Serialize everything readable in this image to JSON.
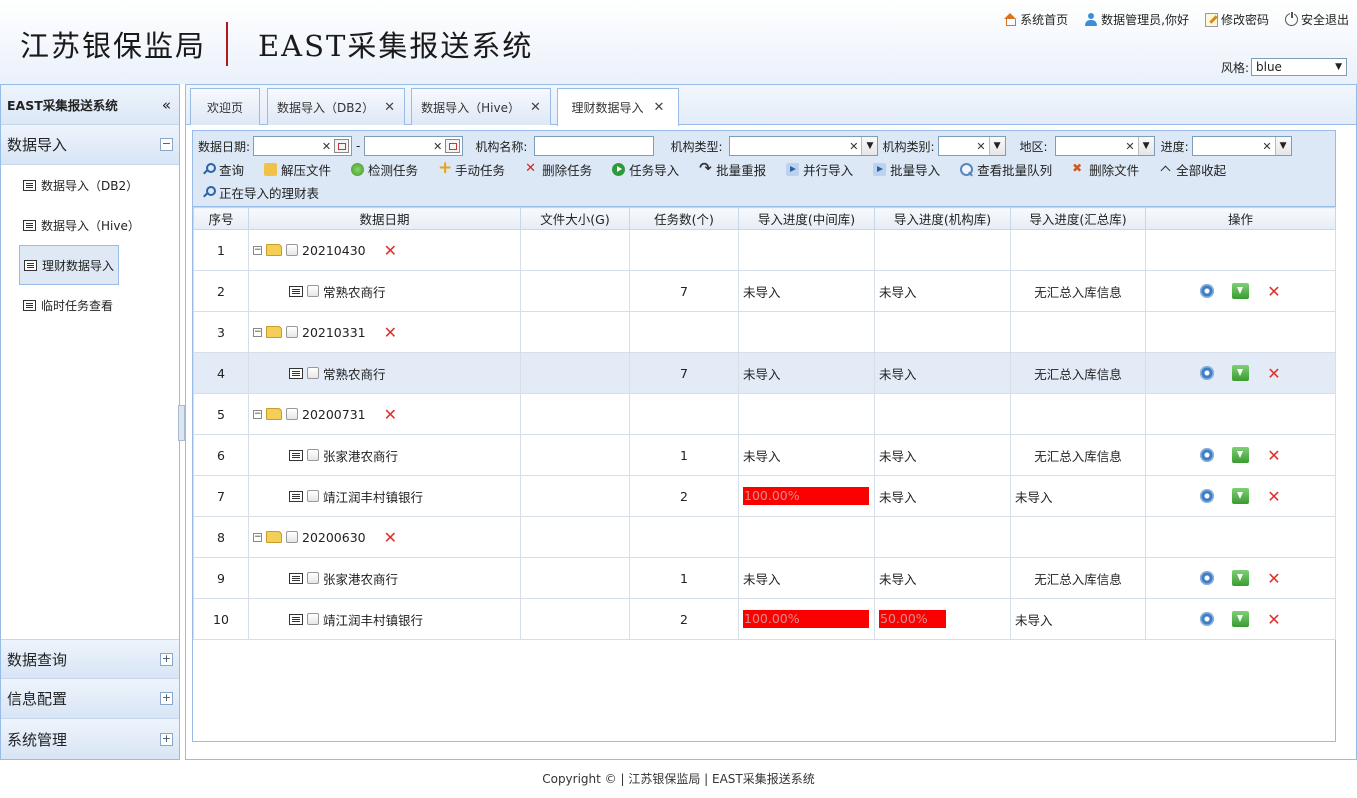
{
  "header": {
    "org_name": "江苏银保监局",
    "system_name": "EAST采集报送系统",
    "links": [
      {
        "label": "系统首页",
        "icon": "home-icon"
      },
      {
        "label": "数据管理员,你好",
        "icon": "user-icon"
      },
      {
        "label": "修改密码",
        "icon": "edit-icon"
      },
      {
        "label": "安全退出",
        "icon": "power-icon"
      }
    ],
    "style_label": "风格:",
    "style_value": "blue"
  },
  "sidebar": {
    "title": "EAST采集报送系统",
    "collapse_glyph": "«",
    "groups": [
      {
        "label": "数据导入",
        "toggle": "−"
      },
      {
        "label": "数据查询",
        "toggle": "+"
      },
      {
        "label": "信息配置",
        "toggle": "+"
      },
      {
        "label": "系统管理",
        "toggle": "+"
      }
    ],
    "items": [
      {
        "label": "数据导入（DB2）"
      },
      {
        "label": "数据导入（Hive）"
      },
      {
        "label": "理财数据导入"
      },
      {
        "label": "临时任务查看"
      }
    ]
  },
  "tabs": [
    {
      "label": "欢迎页"
    },
    {
      "label": "数据导入（DB2）",
      "close": "✕"
    },
    {
      "label": "数据导入（Hive）",
      "close": "✕"
    },
    {
      "label": "理财数据导入",
      "close": "✕"
    }
  ],
  "filters": {
    "date_label": "数据日期:",
    "date_sep": "-",
    "org_name_label": "机构名称:",
    "org_type_label": "机构类型:",
    "org_class_label": "机构类别:",
    "region_label": "地区:",
    "progress_label": "进度:",
    "clear_glyph": "✕",
    "dropdown_glyph": "▼"
  },
  "buttons": [
    {
      "label": "查询",
      "icon": "search-icon"
    },
    {
      "label": "解压文件",
      "icon": "unzip-icon"
    },
    {
      "label": "检测任务",
      "icon": "check-icon"
    },
    {
      "label": "手动任务",
      "icon": "plus-icon"
    },
    {
      "label": "删除任务",
      "icon": "delete-icon"
    },
    {
      "label": "任务导入",
      "icon": "play-icon"
    },
    {
      "label": "批量重报",
      "icon": "redo-icon"
    },
    {
      "label": "并行导入",
      "icon": "arrow-icon"
    },
    {
      "label": "批量导入",
      "icon": "arrow-icon"
    },
    {
      "label": "查看批量队列",
      "icon": "magnify-icon"
    },
    {
      "label": "删除文件",
      "icon": "delete-file-icon"
    },
    {
      "label": "全部收起",
      "icon": "chevron-up-icon"
    },
    {
      "label": "正在导入的理财表",
      "icon": "search-icon"
    }
  ],
  "table": {
    "headers": [
      "序号",
      "数据日期",
      "文件大小(G)",
      "任务数(个)",
      "导入进度(中间库)",
      "导入进度(机构库)",
      "导入进度(汇总库)",
      "操作"
    ],
    "rows": [
      {
        "no": "1",
        "type": "group",
        "name": "20210430"
      },
      {
        "no": "2",
        "type": "item",
        "name": "常熟农商行",
        "size": "",
        "tasks": "7",
        "mid": "未导入",
        "org": "未导入",
        "sum": "无汇总入库信息"
      },
      {
        "no": "3",
        "type": "group",
        "name": "20210331"
      },
      {
        "no": "4",
        "type": "item",
        "name": "常熟农商行",
        "size": "",
        "tasks": "7",
        "mid": "未导入",
        "org": "未导入",
        "sum": "无汇总入库信息",
        "selected": true
      },
      {
        "no": "5",
        "type": "group",
        "name": "20200731"
      },
      {
        "no": "6",
        "type": "item",
        "name": "张家港农商行",
        "size": "",
        "tasks": "1",
        "mid": "未导入",
        "org": "未导入",
        "sum": "无汇总入库信息"
      },
      {
        "no": "7",
        "type": "item",
        "name": "靖江润丰村镇银行",
        "size": "",
        "tasks": "2",
        "mid": "100.00%",
        "mid_pct": 100,
        "org": "未导入",
        "sum": "未导入",
        "sum_left": true
      },
      {
        "no": "8",
        "type": "group",
        "name": "20200630"
      },
      {
        "no": "9",
        "type": "item",
        "name": "张家港农商行",
        "size": "",
        "tasks": "1",
        "mid": "未导入",
        "org": "未导入",
        "sum": "无汇总入库信息"
      },
      {
        "no": "10",
        "type": "item",
        "name": "靖江润丰村镇银行",
        "size": "",
        "tasks": "2",
        "mid": "100.00%",
        "mid_pct": 100,
        "org": "50.00%",
        "org_pct": 50,
        "sum": "未导入",
        "sum_left": true
      }
    ]
  },
  "footer": "Copyright © | 江苏银保监局 | EAST采集报送系统",
  "colors": {
    "progress_bar": "#fc0000",
    "accent": "#99bbe8",
    "delete": "#e0302a"
  }
}
